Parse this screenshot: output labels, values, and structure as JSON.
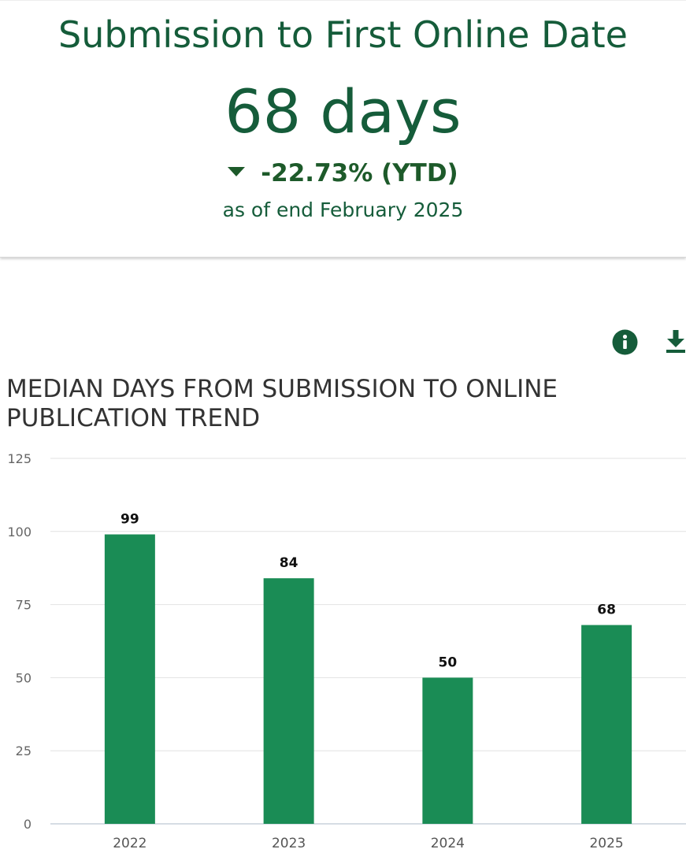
{
  "card": {
    "title": "Submission to First Online Date",
    "value": "68 days",
    "change": "-22.73% (YTD)",
    "as_of": "as of end February 2025",
    "colors": {
      "primary": "#155c3a",
      "change": "#1d5a2a"
    }
  },
  "icons": {
    "info": "info-icon",
    "download": "download-icon"
  },
  "chart_data": {
    "type": "bar",
    "title": "MEDIAN DAYS FROM SUBMISSION TO ONLINE PUBLICATION TREND",
    "categories": [
      "2022",
      "2023",
      "2024",
      "2025"
    ],
    "values": [
      99,
      84,
      50,
      68
    ],
    "ylim": [
      0,
      125
    ],
    "yticks": [
      0,
      25,
      50,
      75,
      100,
      125
    ],
    "grid": true,
    "bar_color": "#1a8c55"
  }
}
